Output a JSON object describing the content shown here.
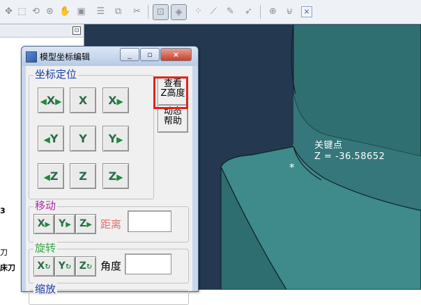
{
  "toolbar": {
    "icons": [
      "move-icon",
      "select-icon",
      "rotate-icon",
      "zoom-icon",
      "pan-icon",
      "shade-icon",
      "list-icon",
      "copy-icon",
      "cut-icon",
      "fit-icon",
      "surface-icon",
      "points-icon",
      "measure-icon",
      "paint-icon",
      "arrow-icon",
      "info-icon",
      "ruler-icon",
      "close-icon"
    ],
    "close_label": "×"
  },
  "left_panel": {
    "pin_label": "⊡",
    "fragments": [
      "3",
      "刀",
      "床刀"
    ]
  },
  "viewport": {
    "annotation_title": "关键点",
    "annotation_value": "Z = -36.58652",
    "marker": "*"
  },
  "dialog": {
    "title": "模型坐标编辑",
    "minimize_label": "_",
    "restore_label": "▫",
    "close_label": "×",
    "coord_group": {
      "title": "坐标定位",
      "buttons": [
        {
          "axis": "X",
          "prefix": "◀",
          "suffix": "▶"
        },
        {
          "axis": "X",
          "prefix": "",
          "suffix": ""
        },
        {
          "axis": "X",
          "prefix": "",
          "suffix": "▶"
        },
        {
          "axis": "Y",
          "prefix": "◀",
          "suffix": ""
        },
        {
          "axis": "Y",
          "prefix": "",
          "suffix": ""
        },
        {
          "axis": "Y",
          "prefix": "",
          "suffix": "▶"
        },
        {
          "axis": "Z",
          "prefix": "◀",
          "suffix": ""
        },
        {
          "axis": "Z",
          "prefix": "",
          "suffix": ""
        },
        {
          "axis": "Z",
          "prefix": "",
          "suffix": "▶"
        }
      ]
    },
    "view_z_button": {
      "line1": "查看",
      "line2": "Z高度"
    },
    "help_button": {
      "line1": "动态",
      "line2": "帮助"
    },
    "move_group": {
      "title": "移动",
      "buttons": [
        {
          "axis": "X",
          "suffix": "▶"
        },
        {
          "axis": "Y",
          "suffix": "▶"
        },
        {
          "axis": "Z",
          "suffix": "▶"
        }
      ],
      "distance_label": "距离",
      "distance_value": ""
    },
    "rotate_group": {
      "title": "旋转",
      "buttons": [
        {
          "axis": "X",
          "suffix": "↻"
        },
        {
          "axis": "Y",
          "suffix": "↻"
        },
        {
          "axis": "Z",
          "suffix": "↻"
        }
      ],
      "angle_label": "角度",
      "angle_value": ""
    },
    "scale_group": {
      "title": "缩放"
    }
  },
  "colors": {
    "viewport_bg": "#24384f",
    "model_face": "#3f8a8a",
    "highlight": "#e0231f",
    "coord_title": "#1a3ea8",
    "move_title": "#b328a8",
    "rotate_title": "#3aa84a",
    "distance_label": "#e07070"
  }
}
